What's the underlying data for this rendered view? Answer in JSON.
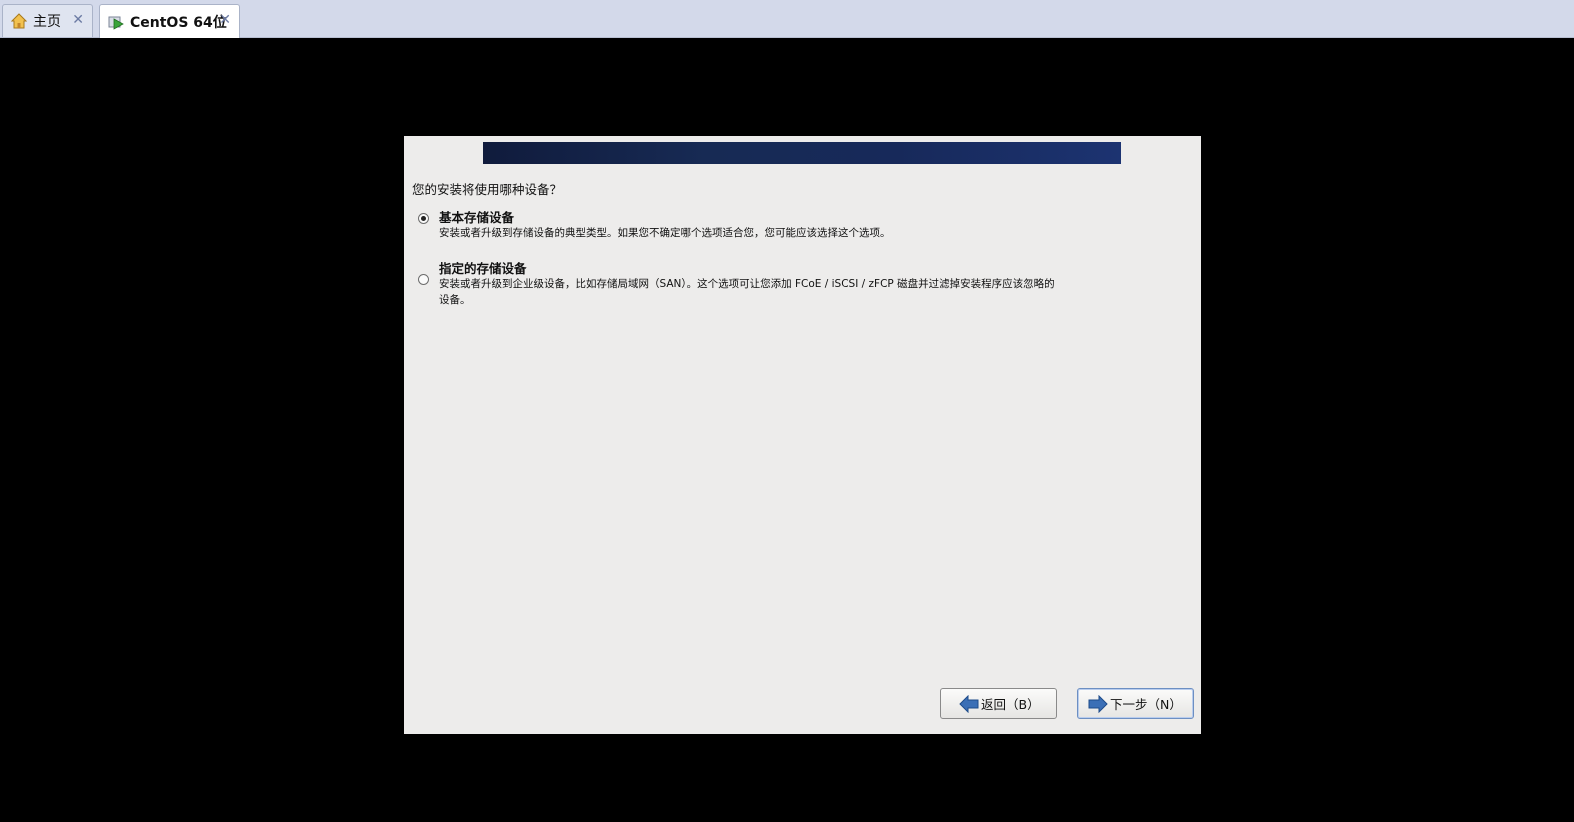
{
  "tabs": [
    {
      "label": "主页",
      "icon": "home-icon",
      "active": false
    },
    {
      "label": "CentOS 64位",
      "icon": "vm-play-icon",
      "active": true
    }
  ],
  "tab_close_glyph": "✕",
  "installer": {
    "question": "您的安装将使用哪种设备？",
    "options": [
      {
        "title": "基本存储设备",
        "description": "安装或者升级到存储设备的典型类型。如果您不确定哪个选项适合您，您可能应该选择这个选项。",
        "selected": true
      },
      {
        "title": "指定的存储设备",
        "description": "安装或者升级到企业级设备，比如存储局域网（SAN）。这个选项可让您添加 FCoE / iSCSI / zFCP 磁盘并过滤掉安装程序应该忽略的设备。",
        "selected": false
      }
    ],
    "buttons": {
      "back": "返回（B）",
      "next": "下一步（N）"
    }
  },
  "colors": {
    "tabbar": "#d3d9ea",
    "installer_bg": "#edeceb",
    "banner": "#172a54",
    "arrow": "#3b6fb6"
  }
}
